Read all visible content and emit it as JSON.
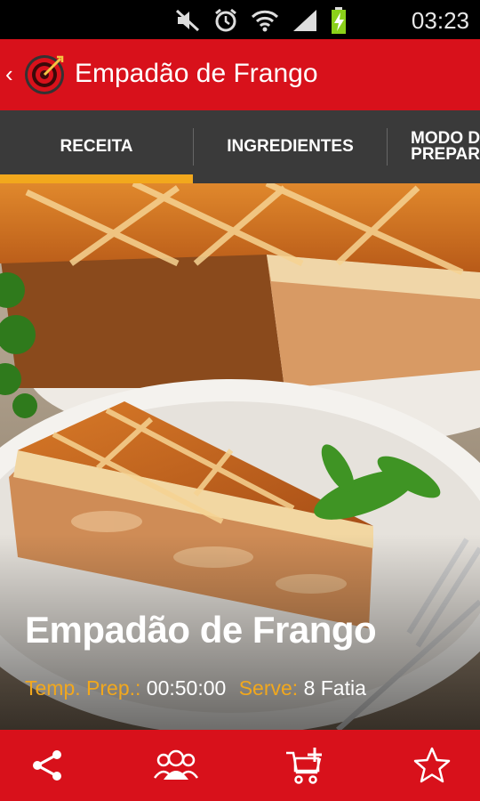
{
  "status_bar": {
    "time": "03:23",
    "icons": [
      "mute-icon",
      "alarm-icon",
      "wifi-icon",
      "signal-icon",
      "battery-charging-icon"
    ]
  },
  "action_bar": {
    "back_glyph": "‹",
    "title": "Empadão de Frango",
    "logo_icon": "target-logo-icon"
  },
  "tabs": [
    {
      "label": "RECEITA",
      "selected": true
    },
    {
      "label": "INGREDIENTES",
      "selected": false
    },
    {
      "label": "MODO DE PREPARO",
      "line1": "MODO D",
      "line2": "PREPAR",
      "selected": false
    }
  ],
  "recipe": {
    "title": "Empadão de Frango",
    "prep_label": "Temp. Prep.:",
    "prep_value": "00:50:00",
    "serves_label": "Serve:",
    "serves_value": "8 Fatia"
  },
  "bottom_bar": {
    "actions": [
      "share-icon",
      "friends-icon",
      "add-to-cart-icon",
      "favorite-star-icon"
    ]
  },
  "colors": {
    "primary_red": "#d8111b",
    "accent_orange": "#f2a81d",
    "tab_bg": "#3a3a3a"
  }
}
